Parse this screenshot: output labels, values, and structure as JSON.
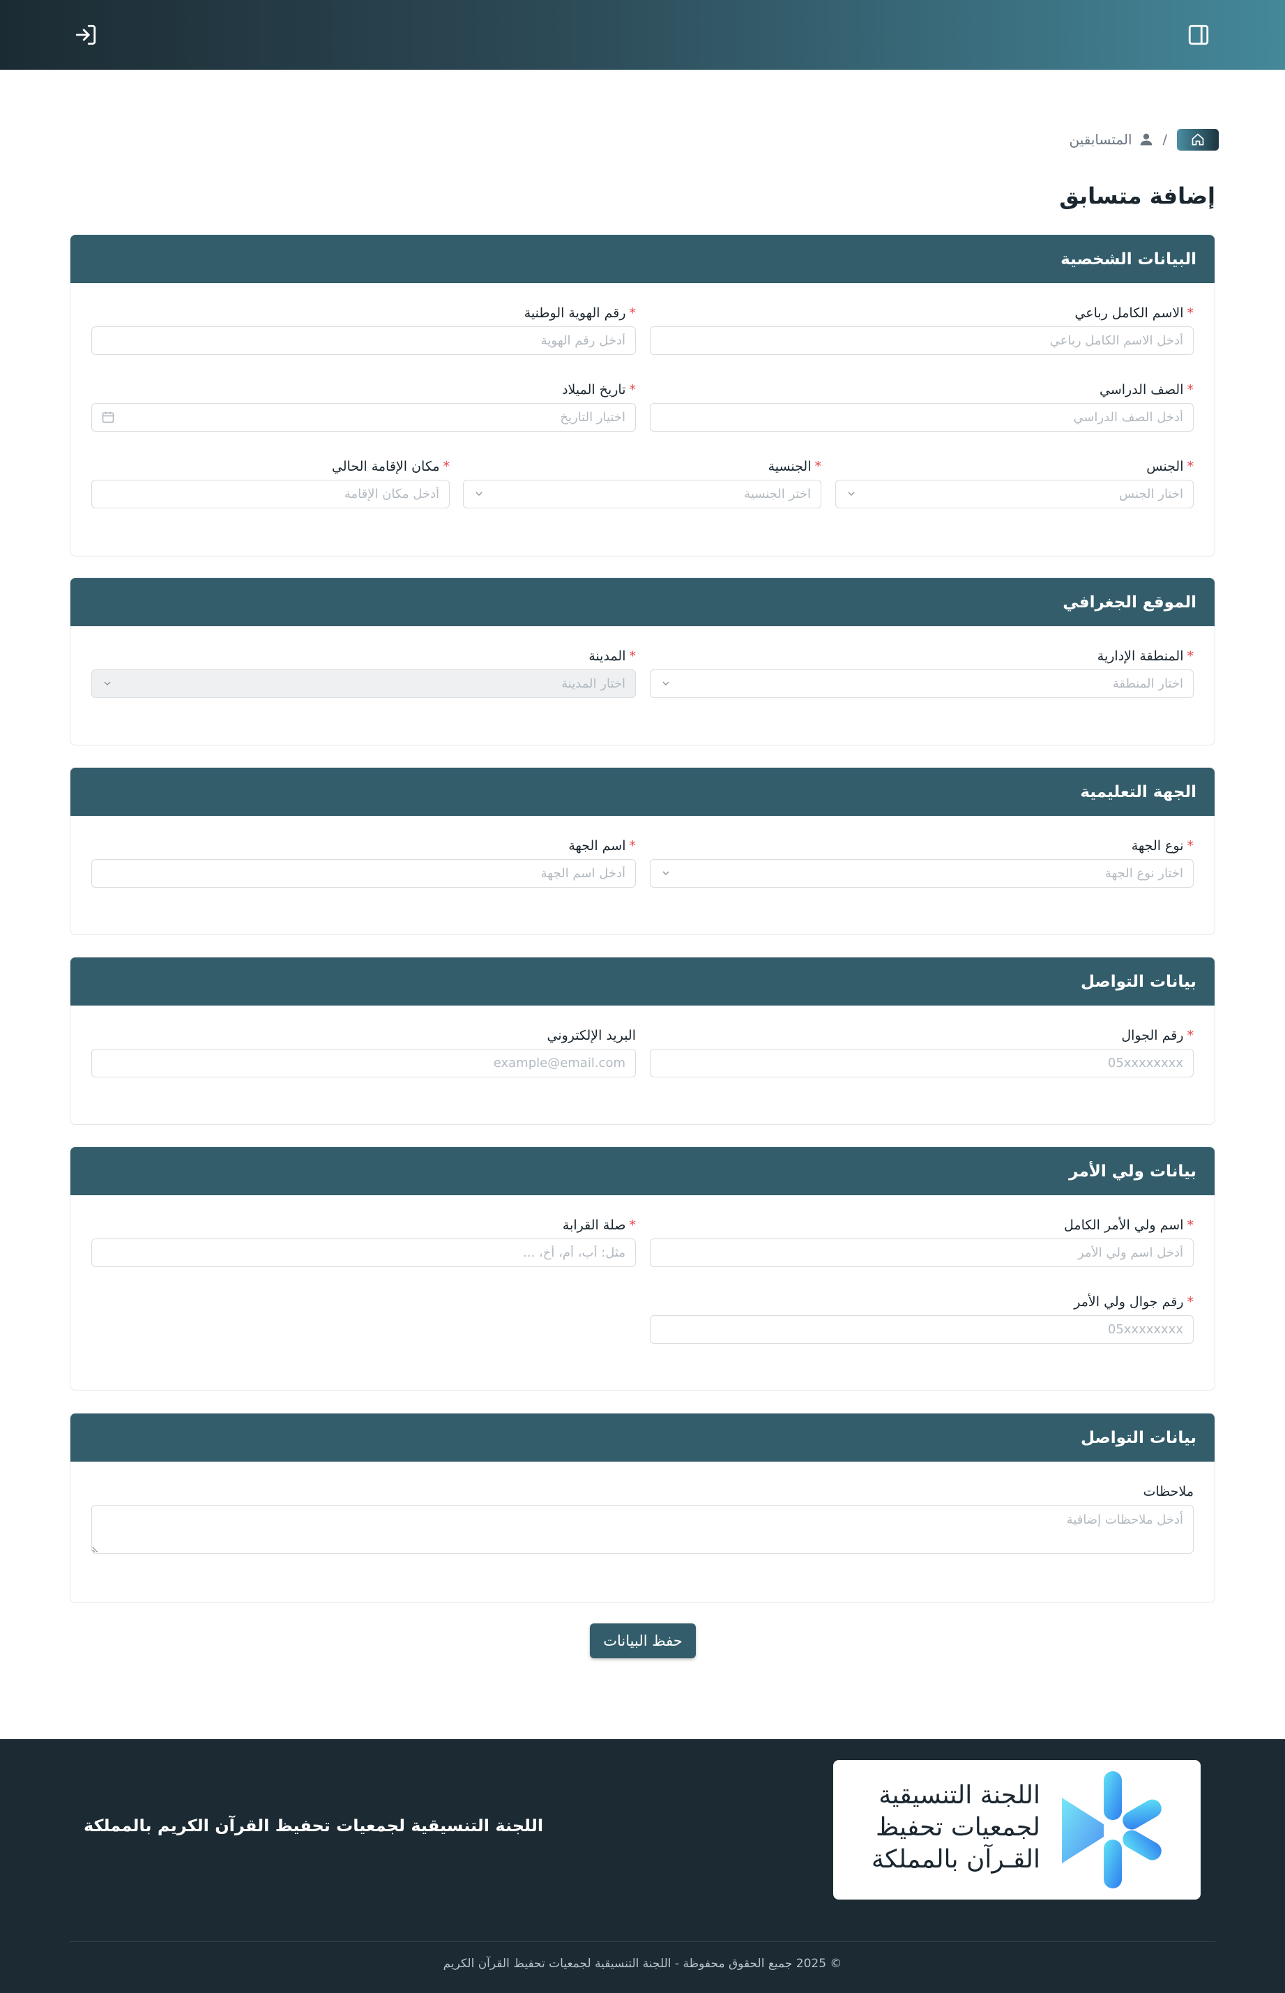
{
  "breadcrumb": {
    "current": "المتسابقين",
    "separator": "/"
  },
  "page_title": "إضافة متسابق",
  "sections": {
    "personal": {
      "title": "البيانات الشخصية",
      "full_name": {
        "label": "الاسم الكامل رباعي",
        "placeholder": "أدخل الاسم الكامل رباعي"
      },
      "national_id": {
        "label": "رقم الهوية الوطنية",
        "placeholder": "أدخل رقم الهوية"
      },
      "grade": {
        "label": "الصف الدراسي",
        "placeholder": "أدخل الصف الدراسي"
      },
      "birth_date": {
        "label": "تاريخ الميلاد",
        "placeholder": "اختيار التاريخ"
      },
      "gender": {
        "label": "الجنس",
        "placeholder": "اختار الجنس"
      },
      "nationality": {
        "label": "الجنسية",
        "placeholder": "اختر الجنسية"
      },
      "residence": {
        "label": "مكان الإقامة الحالي",
        "placeholder": "أدخل مكان الإقامة"
      }
    },
    "location": {
      "title": "الموقع الجغرافي",
      "region": {
        "label": "المنطقة الإدارية",
        "placeholder": "اختار المنطقة"
      },
      "city": {
        "label": "المدينة",
        "placeholder": "اختار المدينة"
      }
    },
    "education": {
      "title": "الجهة التعليمية",
      "entity_type": {
        "label": "نوع الجهة",
        "placeholder": "اختار نوع الجهة"
      },
      "entity_name": {
        "label": "اسم الجهة",
        "placeholder": "أدخل اسم الجهة"
      }
    },
    "contact": {
      "title": "بيانات التواصل",
      "mobile": {
        "label": "رقم الجوال",
        "placeholder": "05xxxxxxxx"
      },
      "email": {
        "label": "البريد الإلكتروني",
        "placeholder": "example@email.com"
      }
    },
    "guardian": {
      "title": "بيانات ولي الأمر",
      "name": {
        "label": "اسم ولي الأمر الكامل",
        "placeholder": "أدخل اسم ولي الأمر"
      },
      "relation": {
        "label": "صلة القرابة",
        "placeholder": "مثل: أب، أم، أخ، ..."
      },
      "mobile": {
        "label": "رقم جوال ولي الأمر",
        "placeholder": "05xxxxxxxx"
      }
    },
    "notes": {
      "title": "بيانات التواصل",
      "notes": {
        "label": "ملاحظات",
        "placeholder": "أدخل ملاحظات إضافية"
      }
    }
  },
  "submit_label": "حفظ البيانات",
  "footer": {
    "logo_line1": "اللجنة التنسيقية",
    "logo_line2": "لجمعيات تحفيظ",
    "logo_line3": "القـرآن بالمملكة",
    "tagline": "اللجنة التنسيقية لجمعيات تحفيظ القرآن الكريم بالمملكة",
    "copyright": "© 2025 جميع الحقوق محفوظة - اللجنة التنسيقية لجمعيات تحفيظ القرآن الكريم"
  },
  "colors": {
    "header": "#335d6b",
    "required": "#e5484d",
    "footer_bg": "#1c2a33"
  },
  "icons": [
    "sidebar-toggle-icon",
    "login-icon",
    "home-icon",
    "user-icon",
    "chevron-down-icon",
    "calendar-icon"
  ]
}
